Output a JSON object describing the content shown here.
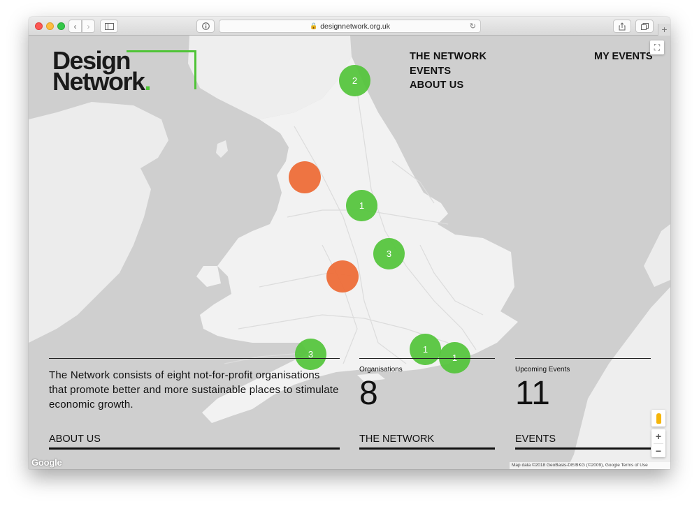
{
  "browser": {
    "url": "designnetwork.org.uk"
  },
  "logo": {
    "line1": "Design",
    "line2": "Network",
    "dot": "."
  },
  "nav": {
    "items": [
      "THE NETWORK",
      "EVENTS",
      "ABOUT US"
    ],
    "my_events": "MY EVENTS"
  },
  "map": {
    "markers": [
      {
        "label": "2",
        "color": "green"
      },
      {
        "label": "",
        "color": "orange"
      },
      {
        "label": "1",
        "color": "green"
      },
      {
        "label": "3",
        "color": "green"
      },
      {
        "label": "",
        "color": "orange"
      },
      {
        "label": "3",
        "color": "green"
      },
      {
        "label": "1",
        "color": "green"
      },
      {
        "label": "1",
        "color": "green"
      }
    ],
    "google": "Google",
    "attribution": "Map data ©2018 GeoBasis-DE/BKG (©2009), Google    Terms of Use",
    "zoom_in": "+",
    "zoom_out": "−",
    "colors": {
      "green": "#52c439",
      "orange": "#ee6a35",
      "land": "#efefef",
      "water": "#cfcfcf"
    }
  },
  "intro": {
    "text": "The Network consists of eight not-for-profit organisations that promote better and more sustainable places to stimulate economic growth."
  },
  "stats": {
    "organisations": {
      "label": "Organisations",
      "value": "8"
    },
    "events": {
      "label": "Upcoming Events",
      "value": "11"
    }
  },
  "footer": {
    "about": "ABOUT US",
    "network": "THE NETWORK",
    "events": "EVENTS"
  }
}
